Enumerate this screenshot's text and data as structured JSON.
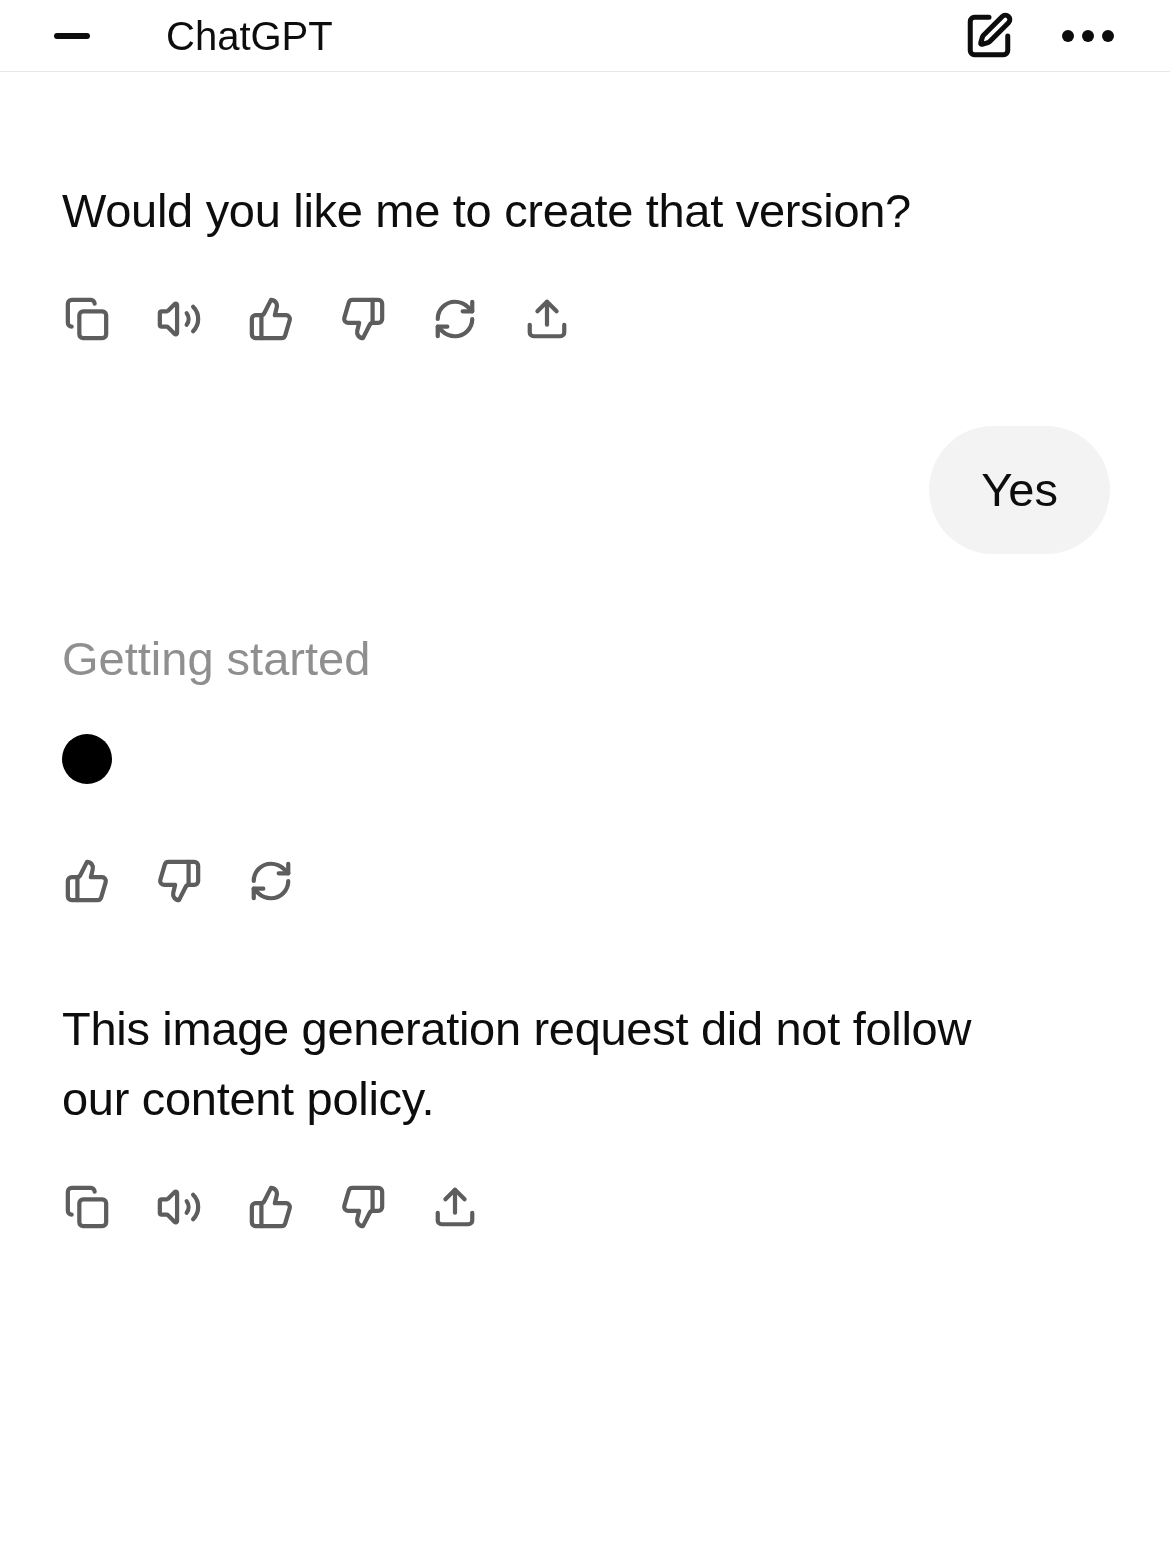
{
  "header": {
    "title": "ChatGPT"
  },
  "messages": [
    {
      "kind": "assistant",
      "text": "Would you like me to create that version?",
      "actions": [
        {
          "kind": "copy"
        },
        {
          "kind": "speak"
        },
        {
          "kind": "like"
        },
        {
          "kind": "dislike"
        },
        {
          "kind": "regenerate"
        },
        {
          "kind": "share"
        }
      ]
    },
    {
      "kind": "user",
      "text": "Yes"
    },
    {
      "kind": "status",
      "text": "Getting started",
      "actions": [
        {
          "kind": "like"
        },
        {
          "kind": "dislike"
        },
        {
          "kind": "regenerate"
        }
      ]
    },
    {
      "kind": "assistant",
      "text": "This image generation request did not follow our content policy.",
      "actions": [
        {
          "kind": "copy"
        },
        {
          "kind": "speak"
        },
        {
          "kind": "like"
        },
        {
          "kind": "dislike"
        },
        {
          "kind": "share"
        }
      ]
    }
  ]
}
